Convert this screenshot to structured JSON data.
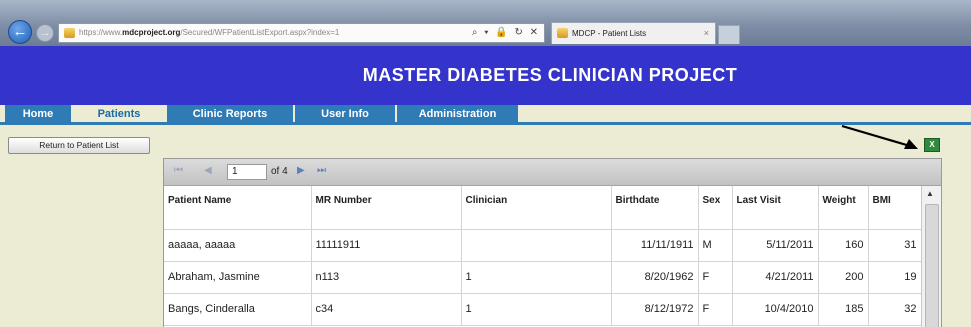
{
  "browser": {
    "url_prefix": "https://www.",
    "url_host": "mdcproject.org",
    "url_path": "/Secured/WFPatientListExport.aspx?index=1",
    "address_controls": "⌕ ▾ 🔒 ↻ ✕",
    "tab_title": "MDCP - Patient Lists",
    "tab_close": "×"
  },
  "header": {
    "title": "MASTER DIABETES CLINICIAN PROJECT"
  },
  "menu": [
    {
      "label": "Home"
    },
    {
      "label": "Patients"
    },
    {
      "label": "Clinic Reports"
    },
    {
      "label": "User Info"
    },
    {
      "label": "Administration"
    }
  ],
  "return_button": {
    "label": "Return to Patient List"
  },
  "export": {
    "icon": "excel-export-icon",
    "glyph": "X"
  },
  "pager": {
    "first": "⏮",
    "prev": "◀",
    "page_value": "1",
    "of_text": "of 4",
    "next": "▶",
    "last": "⏭"
  },
  "table": {
    "headers": [
      "Patient Name",
      "MR Number",
      "Clinician",
      "Birthdate",
      "Sex",
      "Last Visit",
      "Weight",
      "BMI"
    ],
    "rows": [
      [
        "aaaaa, aaaaa",
        "11111911",
        "",
        "11/11/1911",
        "M",
        "5/11/2011",
        "160",
        "31"
      ],
      [
        "Abraham, Jasmine",
        "n113",
        "1",
        "8/20/1962",
        "F",
        "4/21/2011",
        "200",
        "19"
      ],
      [
        "Bangs, Cinderalla",
        "c34",
        "1",
        "8/12/1972",
        "F",
        "10/4/2010",
        "185",
        "32"
      ]
    ]
  },
  "colors": {
    "banner": "#3434cc",
    "menu": "#2e7bb5",
    "page_bg": "#ecebd4"
  }
}
